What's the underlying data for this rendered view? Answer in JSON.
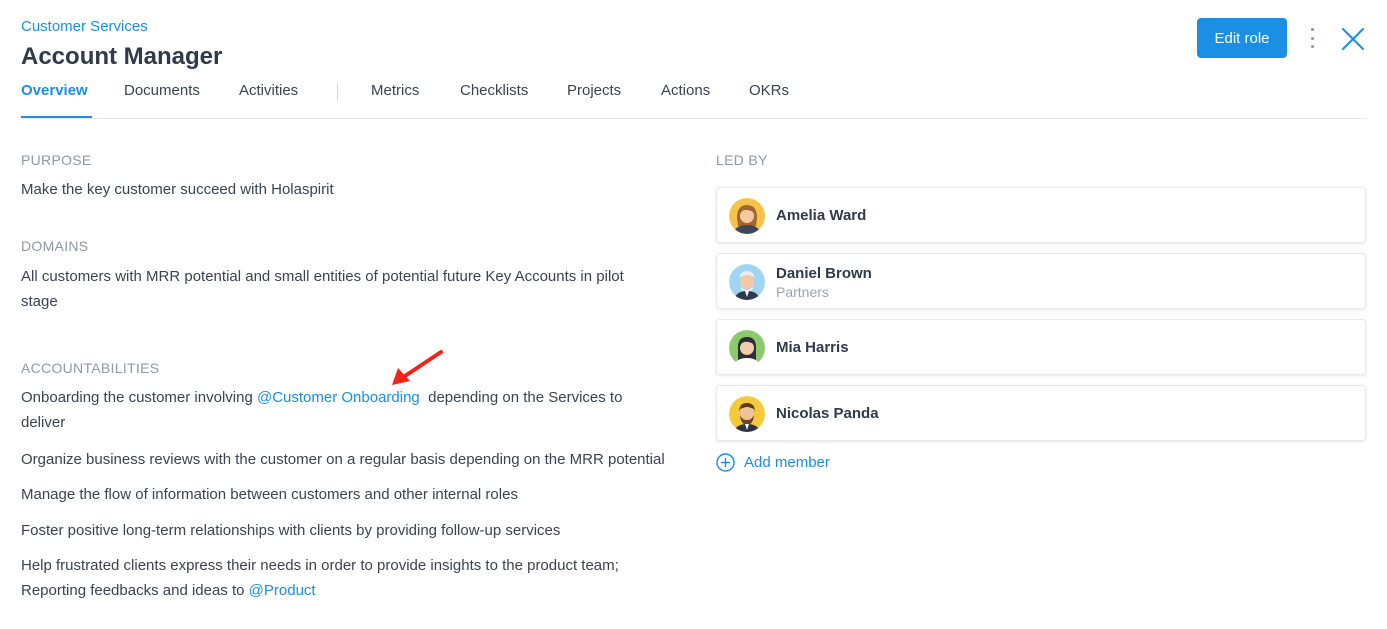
{
  "header": {
    "breadcrumb": "Customer Services",
    "title": "Account Manager",
    "edit_label": "Edit role"
  },
  "tabs": [
    {
      "label": "Overview",
      "active": true
    },
    {
      "label": "Documents"
    },
    {
      "label": "Activities"
    },
    {
      "label": "Metrics"
    },
    {
      "label": "Checklists"
    },
    {
      "label": "Projects"
    },
    {
      "label": "Actions"
    },
    {
      "label": "OKRs"
    }
  ],
  "purpose": {
    "label": "PURPOSE",
    "text": "Make the key customer succeed with Holaspirit"
  },
  "domains": {
    "label": "DOMAINS",
    "text": "All customers with MRR potential and small entities of potential future Key Accounts in pilot stage"
  },
  "accountabilities": {
    "label": "ACCOUNTABILITIES",
    "item1_before": "Onboarding the customer involving ",
    "item1_mention": "@Customer Onboarding",
    "item1_after": "  depending on the Services to deliver",
    "item2": "Organize business reviews with the customer on a regular basis depending on the MRR potential",
    "item3": "Manage the flow of information between customers and other internal roles",
    "item4": "Foster positive long-term relationships with clients by providing follow-up services",
    "item5_before": "Help frustrated clients express their needs in order to provide insights to the product team; Reporting feedbacks and ideas to ",
    "item5_mention": "@Product"
  },
  "led_by": {
    "label": "LED BY",
    "members": [
      {
        "name": "Amelia Ward",
        "sub": ""
      },
      {
        "name": "Daniel Brown",
        "sub": "Partners"
      },
      {
        "name": "Mia Harris",
        "sub": ""
      },
      {
        "name": "Nicolas Panda",
        "sub": ""
      }
    ],
    "add_label": "Add member"
  },
  "icons": {
    "more": "more-vertical-icon",
    "close": "close-icon",
    "add": "plus-circle-icon",
    "annotation": "red-arrow-icon"
  },
  "colors": {
    "accent": "#1a8fe3",
    "annotation": "#f0241b"
  }
}
